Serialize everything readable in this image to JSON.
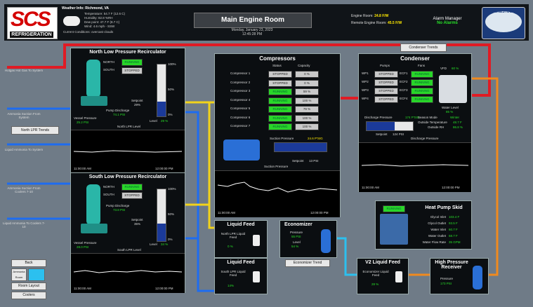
{
  "header": {
    "logo_text": "SCS",
    "logo_sub": "REFRIGERATION",
    "weather_title": "Weather Info: Richmond, VA",
    "weather_lines": [
      "Temperature: 54.7 F (12.6 C)",
      "Humidity: 82.8 %RH",
      "Dew point: 47.7 F (8.7 C)",
      "Wind: 4.6 mph - SSW",
      "Current Conditions: overcast clouds"
    ],
    "title": "Main Engine Room",
    "date_line1": "Monday, January 23, 2023",
    "date_line2": "12:45:28 PM",
    "engine_room_label": "Engine Room:",
    "engine_room_value": "24.8 F/W",
    "remote_label": "Remote Engine Room:",
    "remote_value": "45.5 F/W",
    "alarm_label": "Alarm Manager",
    "alarm_status": "No Alarms",
    "partner_logo": "CONESTOGA"
  },
  "left_labels": {
    "hot_gas": "Hotgas Hot Gas To System",
    "suction1": "Ammonia Suction From System",
    "nlpr_trends": "North LPR Trends",
    "liquid1": "Liquid Ammonia To System",
    "suction2": "Ammonia Suction From Coolers 7-10",
    "liquid2": "Liquid Ammonia To Coolers 7-10"
  },
  "north_lpr": {
    "title": "North Low Pressure Recirculator",
    "north_label": "NORTH",
    "north_status": "RUNNING",
    "south_label": "SOUTH",
    "south_status": "STOPPED",
    "pump_discharge_label": "Pump Discharge",
    "pump_discharge_value": "74.1 PSI",
    "setpoint_label": "Setpoint",
    "setpoint_value": "29%",
    "vessel_pressure_label": "Vessel Pressure",
    "vessel_pressure_value": "25.2 PSI",
    "level_label": "Level",
    "level_value": "29 %",
    "level_fraction": 0.29,
    "scale": [
      "100%",
      "50%",
      "0%"
    ],
    "trend_label": "North LPR Level"
  },
  "south_lpr": {
    "title": "South Low Pressure Recirculator",
    "north_label": "NORTH",
    "north_status": "RUNNING",
    "south_label": "SOUTH",
    "south_status": "STOPPED",
    "pump_discharge_label": "Pump Discharge",
    "pump_discharge_value": "73.8 PSI",
    "setpoint_label": "Setpoint",
    "setpoint_value": "35%",
    "vessel_pressure_label": "Vessel Pressure",
    "vessel_pressure_value": "28.0 PSI",
    "level_label": "Level",
    "level_value": "34 %",
    "level_fraction": 0.34,
    "scale": [
      "100%",
      "50%",
      "0%"
    ],
    "trend_label": "South LPR Level"
  },
  "compressors": {
    "title": "Compressors",
    "status_header": "Status",
    "capacity_header": "Capacity",
    "rows": [
      {
        "name": "Compressor 1",
        "status": "STOPPED",
        "capacity": "0 %"
      },
      {
        "name": "Compressor 2",
        "status": "STOPPED",
        "capacity": "0 %"
      },
      {
        "name": "Compressor 3",
        "status": "RUNNING",
        "capacity": "59 %"
      },
      {
        "name": "Compressor 4",
        "status": "RUNNING",
        "capacity": "100 %"
      },
      {
        "name": "Compressor 5",
        "status": "RUNNING",
        "capacity": "79 %"
      },
      {
        "name": "Compressor 6",
        "status": "RUNNING",
        "capacity": "100 %"
      },
      {
        "name": "Compressor 7",
        "status": "RUNNING",
        "capacity": "100 %"
      }
    ],
    "suction_pressure_label": "Suction Pressure",
    "suction_pressure_value": "24.6 P'SIG",
    "setpoint_label": "Setpoint",
    "setpoint_value": "13 PSI",
    "trend_label": "Suction Pressure"
  },
  "condenser": {
    "title": "Condenser",
    "trends_button": "Condenser Trends",
    "pumps_header": "Pumps",
    "fans_header": "Fans",
    "vfd_label": "VFD",
    "vfd_value": "60 %",
    "pumps": [
      {
        "name": "WP1",
        "status": "STOPPED",
        "fan": "ECF1",
        "fan_status": "RUNNING"
      },
      {
        "name": "WP2",
        "status": "STOPPED",
        "fan": "ECF2",
        "fan_status": "RUNNING"
      },
      {
        "name": "WP3",
        "status": "STOPPED",
        "fan": "ECF3",
        "fan_status": "RUNNING"
      },
      {
        "name": "WP4",
        "status": "STOPPED",
        "fan": "ECF4",
        "fan_status": "RUNNING"
      }
    ],
    "water_level_label": "Water Level",
    "water_level_value": "85 %",
    "discharge_label": "Discharge Pressure",
    "discharge_value": "174 P'SIG",
    "season_label": "Season Mode",
    "season_value": "Winter",
    "outside_temp_label": "Outside Temperature",
    "outside_temp_value": "48.7 F",
    "outside_rh_label": "Outside RH",
    "outside_rh_value": "86.8 %",
    "setpoint_label": "Setpoint",
    "setpoint_value": "124 PSI",
    "trend_label": "Discharge Pressure"
  },
  "heat_pump": {
    "title": "Heat Pump Skid",
    "status": "RUNNING",
    "rows": [
      {
        "label": "Glycol Inlet",
        "value": "103.4 F"
      },
      {
        "label": "Glycol Outlet",
        "value": "93.5 F"
      },
      {
        "label": "Water Inlet",
        "value": "60.7 F"
      },
      {
        "label": "Water Outlet",
        "value": "68.7 F"
      },
      {
        "label": "Water Flow Rate",
        "value": "35 GPM"
      }
    ]
  },
  "liquid_feed_north": {
    "title": "Liquid Feed",
    "label": "North LPR Liquid Feed",
    "value": "0 %"
  },
  "liquid_feed_south": {
    "title": "Liquid Feed",
    "label": "South LPR Liquid Feed",
    "value": "14%"
  },
  "economizer": {
    "title": "Economizer",
    "pressure_label": "Pressure",
    "pressure_value": "55 PSI",
    "level_label": "Level",
    "level_value": "54 %",
    "trends_button": "Economizer Trend"
  },
  "v2_feed": {
    "title": "V2 Liquid Feed",
    "label": "Economizer Liquid Feed",
    "value": "28 %"
  },
  "hpr": {
    "title": "High Pressure Receiver",
    "pressure_label": "Pressure",
    "pressure_value": "173 PSI"
  },
  "bottom_buttons": {
    "back": "Back",
    "ammonia_room": "Ammonia Room",
    "room_layout": "Room Layout",
    "coolers": "Coolers"
  },
  "trend_axis": {
    "left": "11:00:00 AM",
    "right": "12:00:00 PM"
  },
  "colors": {
    "running": "#29d629",
    "stopped": "#c9c9c9",
    "hot_gas_pipe": "#e01b24",
    "suction_pipe": "#1e6cf0",
    "liquid_pipe": "#f2d31b",
    "econ_pipe": "#2cc0ef",
    "hp_pipe": "#f08a1e"
  }
}
